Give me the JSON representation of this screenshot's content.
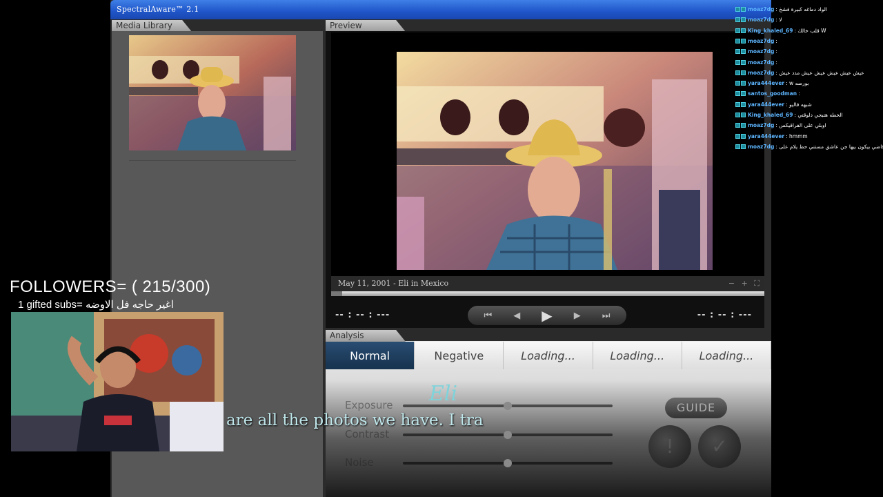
{
  "app": {
    "title": "SpectralAware™ 2.1"
  },
  "library": {
    "tab_label": "Media Library"
  },
  "preview": {
    "tab_label": "Preview",
    "caption": "May 11, 2001 - Eli in Mexico",
    "zoom_controls": "− + ⛶",
    "time_left": "-- : -- : ---",
    "time_right": "-- : -- : ---",
    "transport": {
      "skip_back": "⏮",
      "step_back": "◀",
      "play": "▶",
      "step_forward": "▶",
      "skip_forward": "⏭"
    }
  },
  "analysis": {
    "tab_label": "Analysis",
    "tabs": [
      {
        "label": "Normal"
      },
      {
        "label": "Negative"
      },
      {
        "label": "Loading..."
      },
      {
        "label": "Loading..."
      },
      {
        "label": "Loading..."
      }
    ],
    "sliders": [
      {
        "label": "Exposure",
        "value": 0.5
      },
      {
        "label": "Contrast",
        "value": 0.5
      },
      {
        "label": "Noise",
        "value": 0.5
      }
    ],
    "guide_label": "GUIDE",
    "info_glyph": "!",
    "confirm_glyph": "✓"
  },
  "chat": {
    "lines": [
      {
        "user": "moaz7dg",
        "text": ": الواد دماغه كبيرة فشخ"
      },
      {
        "user": "moaz7dg",
        "text": ": لا"
      },
      {
        "user": "King_khaled_69",
        "text": ": قلب خالك W"
      },
      {
        "user": "moaz7dg",
        "text": ":"
      },
      {
        "user": "moaz7dg",
        "text": ":"
      },
      {
        "user": "moaz7dg",
        "text": ":"
      },
      {
        "user": "moaz7dg",
        "text": ": عيش عيش عيش عيش عيش مدد عيش"
      },
      {
        "user": "yara444ever",
        "text": ": w بورصه"
      },
      {
        "user": "santos_goodman",
        "text": ":"
      },
      {
        "user": "yara444ever",
        "text": ": شبهه قاليو"
      },
      {
        "user": "King_khaled_69",
        "text": ": الخطه هتبجي دلوقتي"
      },
      {
        "user": "moaz7dg",
        "text": ": اوبلي على الفراقيكس"
      },
      {
        "user": "yara444ever",
        "text": ": hmmm"
      },
      {
        "user": "moaz7dg",
        "text": ": يا سرير قاضي بيكون بيها جن عاشق مستني حظ يلام على"
      }
    ]
  },
  "overlay": {
    "followers": "FOLLOWERS= ( 215/300)",
    "gifted": "1 gifted subs= اغير حاجه فل الاوضه",
    "subtitle": "are all the photos we have. I tra",
    "speaker": "Eli"
  }
}
